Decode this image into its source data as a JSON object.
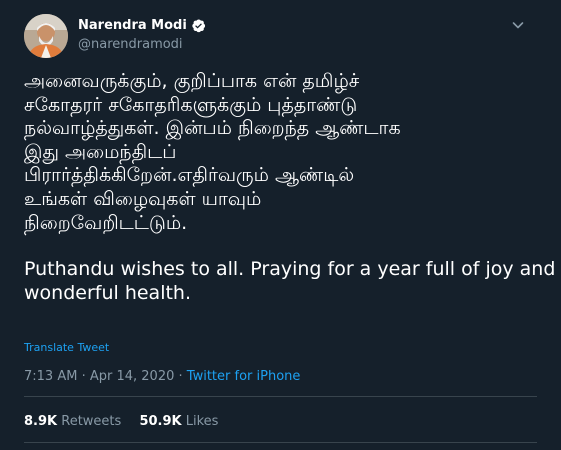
{
  "author": {
    "name": "Narendra Modi",
    "handle": "@narendramodi",
    "verified": true
  },
  "tweet": {
    "lines_tamil": [
      "அனைவருக்கும், குறிப்பாக என் தமிழ்ச்",
      "சகோதரர் சகோதரிகளுக்கும் புத்தாண்டு",
      "நல்வாழ்த்துகள். இன்பம் நிறைந்த ஆண்டாக",
      "இது அமைந்திடப்",
      "பிரார்த்திக்கிறேன்.எதிர்வரும் ஆண்டில்",
      "உங்கள் விழைவுகள் யாவும்",
      "நிறைவேறிடட்டும்."
    ],
    "lines_english": [
      "Puthandu wishes to all. Praying for a year full of joy and",
      "wonderful health."
    ],
    "translate_label": "Translate Tweet",
    "time": "7:13 AM",
    "separator": "·",
    "date": "Apr 14, 2020",
    "source": "Twitter for iPhone"
  },
  "stats": {
    "retweets_count": "8.9K",
    "retweets_label": "Retweets",
    "likes_count": "50.9K",
    "likes_label": "Likes"
  },
  "colors": {
    "background": "#15202b",
    "text": "#ffffff",
    "secondary": "#8899a6",
    "accent": "#1da1f2",
    "divider": "#38444d"
  },
  "icons": {
    "verified": "verified-badge-icon",
    "menu": "chevron-down-icon"
  }
}
